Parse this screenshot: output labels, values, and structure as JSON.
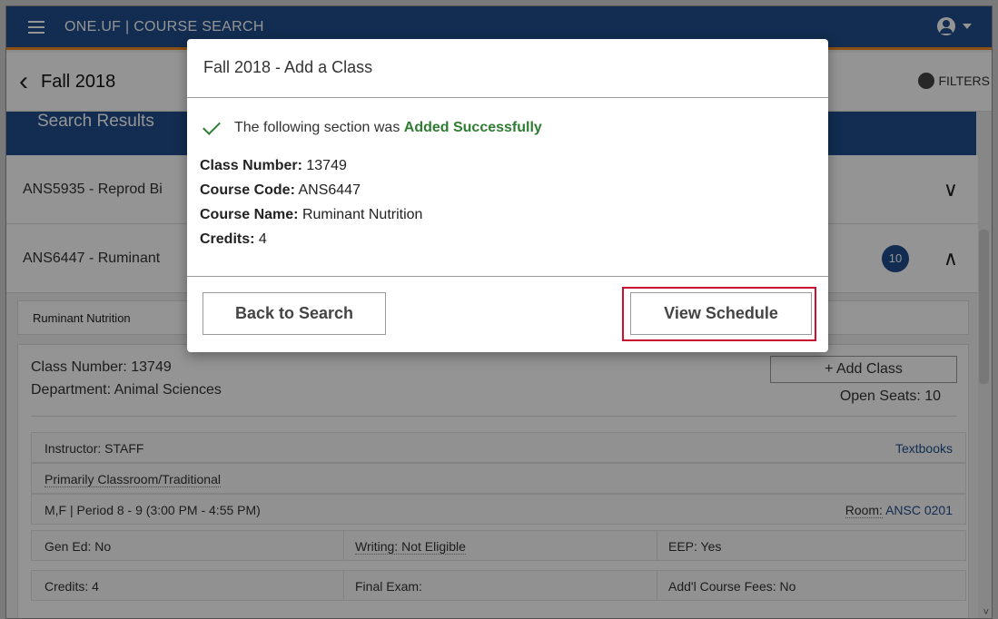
{
  "topbar": {
    "title": "ONE.UF | COURSE SEARCH"
  },
  "subbar": {
    "term": "Fall 2018",
    "filters_label": "FILTERS"
  },
  "results_header": "Search Results",
  "courses": [
    {
      "code": "ANS5935 - Reprod Bi"
    },
    {
      "code": "ANS6447 - Ruminant",
      "badge": "10"
    }
  ],
  "section": {
    "tab_label": "Ruminant Nutrition",
    "class_number": "Class Number: 13749",
    "department": "Department: Animal Sciences",
    "add_class_label": "+ Add Class",
    "open_seats": "Open Seats: 10",
    "instructor": "Instructor: STAFF",
    "textbooks": "Textbooks",
    "mode": "Primarily Classroom/Traditional",
    "meeting": "M,F | Period 8 - 9 (3:00 PM - 4:55 PM)",
    "room_label": "Room:",
    "room": "ANSC 0201",
    "gen_ed": "Gen Ed: No",
    "writing": "Writing: Not Eligible",
    "eep": "EEP: Yes",
    "credits": "Credits: 4",
    "final_exam": "Final Exam:",
    "course_fees": "Add'l Course Fees: No"
  },
  "modal": {
    "title": "Fall 2018 - Add a Class",
    "success_prefix": "The following section was",
    "success_word": "Added Successfully",
    "class_number_label": "Class Number:",
    "class_number": "13749",
    "course_code_label": "Course Code:",
    "course_code": "ANS6447",
    "course_name_label": "Course Name:",
    "course_name": "Ruminant Nutrition",
    "credits_label": "Credits:",
    "credits": "4",
    "back_button": "Back to Search",
    "view_button": "View Schedule"
  },
  "colors": {
    "brand_blue": "#1f4e8c",
    "accent_orange": "#f08a24",
    "success_green": "#2e7d32",
    "highlight_red": "#c8102e"
  },
  "icons": [
    "hamburger-icon",
    "account-icon",
    "caret-down-icon",
    "back-chevron-icon",
    "gear-icon",
    "chevron-down-icon",
    "chevron-up-icon",
    "check-icon"
  ]
}
